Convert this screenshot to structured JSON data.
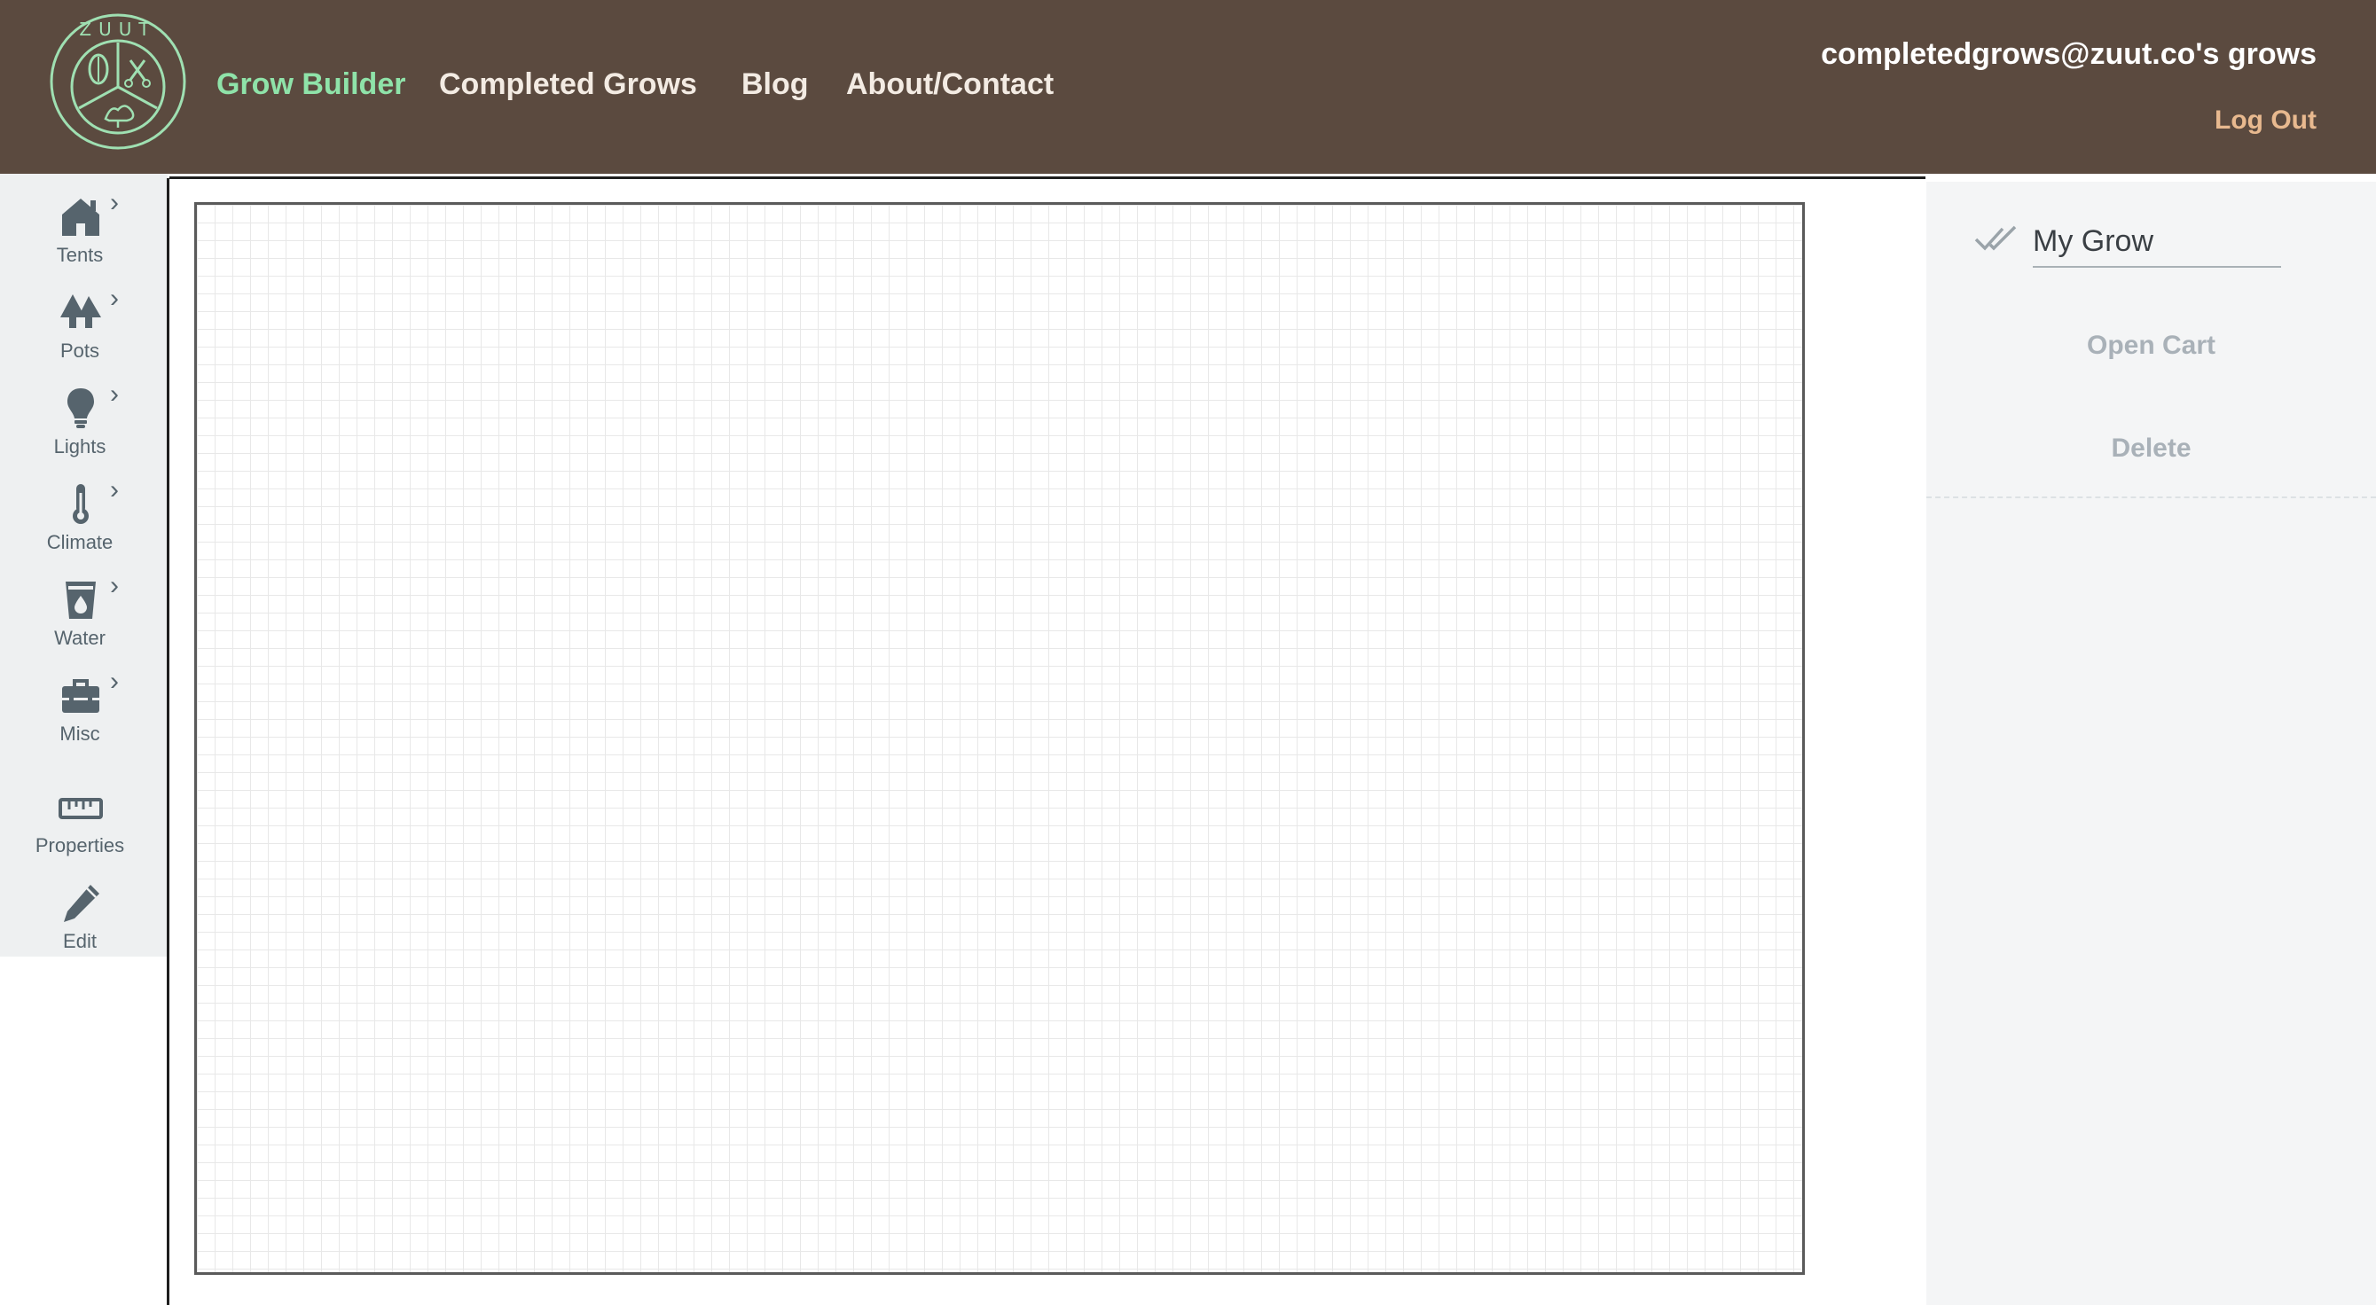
{
  "header": {
    "logo_text": "ZUUT",
    "nav": [
      "Grow Builder",
      "Completed Grows",
      "Blog",
      "About/Contact"
    ],
    "active_nav": "Grow Builder",
    "user_label": "completedgrows@zuut.co's grows",
    "logout_label": "Log Out"
  },
  "sidebar": {
    "items": [
      {
        "label": "Tents",
        "icon": "house-icon",
        "has_submenu": true
      },
      {
        "label": "Pots",
        "icon": "trees-icon",
        "has_submenu": true
      },
      {
        "label": "Lights",
        "icon": "lightbulb-icon",
        "has_submenu": true
      },
      {
        "label": "Climate",
        "icon": "thermometer-icon",
        "has_submenu": true
      },
      {
        "label": "Water",
        "icon": "water-cup-icon",
        "has_submenu": true
      },
      {
        "label": "Misc",
        "icon": "toolbox-icon",
        "has_submenu": true
      },
      {
        "label": "Properties",
        "icon": "ruler-icon",
        "has_submenu": false
      },
      {
        "label": "Edit",
        "icon": "pencil-icon",
        "has_submenu": false
      }
    ]
  },
  "right_panel": {
    "grow_name": "My Grow",
    "open_cart_label": "Open Cart",
    "delete_label": "Delete"
  },
  "colors": {
    "header_bg": "#5b4a3f",
    "active_nav": "#8fe3a9",
    "logout": "#e8b98f",
    "sidebar_bg": "#eef0f1",
    "icon": "#56646d"
  }
}
